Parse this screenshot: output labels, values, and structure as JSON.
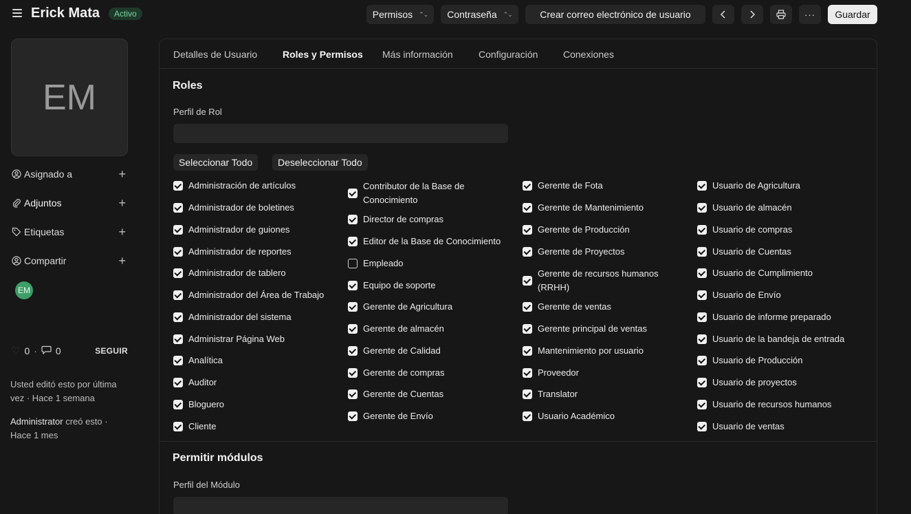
{
  "header": {
    "title": "Erick Mata",
    "status": "Activo",
    "buttons": {
      "permisos": "Permisos",
      "contrasena": "Contraseña",
      "crear_correo": "Crear correo electrónico de usuario",
      "guardar": "Guardar"
    }
  },
  "sidebar": {
    "avatar_initials": "EM",
    "rows": [
      {
        "label": "Asignado a",
        "icon": "user-assign-icon"
      },
      {
        "label": "Adjuntos",
        "icon": "paperclip-icon"
      },
      {
        "label": "Etiquetas",
        "icon": "tag-icon"
      },
      {
        "label": "Compartir",
        "icon": "share-user-icon"
      }
    ],
    "shared_avatar": "EM",
    "likes": "0",
    "comments": "0",
    "follow": "SEGUIR",
    "activity": [
      {
        "actor": "",
        "text": "Usted editó esto por última vez · Hace 1 semana"
      },
      {
        "actor": "Administrator",
        "text": " creó esto · Hace 1 mes"
      }
    ]
  },
  "tabs": [
    {
      "label": "Detalles de Usuario",
      "active": false
    },
    {
      "label": "Roles y Permisos",
      "active": true
    },
    {
      "label": "Más información",
      "active": false
    },
    {
      "label": "Configuración",
      "active": false
    },
    {
      "label": "Conexiones",
      "active": false
    }
  ],
  "roles_section": {
    "title": "Roles",
    "profile_label": "Perfil de Rol",
    "profile_value": "",
    "select_all": "Seleccionar Todo",
    "deselect_all": "Deseleccionar Todo",
    "columns": [
      [
        {
          "label": "Administración de artículos",
          "checked": true
        },
        {
          "label": "Administrador de boletines",
          "checked": true
        },
        {
          "label": "Administrador de guiones",
          "checked": true
        },
        {
          "label": "Administrador de reportes",
          "checked": true
        },
        {
          "label": "Administrador de tablero",
          "checked": true
        },
        {
          "label": "Administrador del Área de Trabajo",
          "checked": true
        },
        {
          "label": "Administrador del sistema",
          "checked": true
        },
        {
          "label": "Administrar Página Web",
          "checked": true
        },
        {
          "label": "Analítica",
          "checked": true
        },
        {
          "label": "Auditor",
          "checked": true
        },
        {
          "label": "Bloguero",
          "checked": true
        },
        {
          "label": "Cliente",
          "checked": true
        }
      ],
      [
        {
          "label": "Contributor de la Base de Conocimiento",
          "checked": true
        },
        {
          "label": "Director de compras",
          "checked": true
        },
        {
          "label": "Editor de la Base de Conocimiento",
          "checked": true
        },
        {
          "label": "Empleado",
          "checked": false
        },
        {
          "label": "Equipo de soporte",
          "checked": true
        },
        {
          "label": "Gerente de Agricultura",
          "checked": true
        },
        {
          "label": "Gerente de almacén",
          "checked": true
        },
        {
          "label": "Gerente de Calidad",
          "checked": true
        },
        {
          "label": "Gerente de compras",
          "checked": true
        },
        {
          "label": "Gerente de Cuentas",
          "checked": true
        },
        {
          "label": "Gerente de Envío",
          "checked": true
        }
      ],
      [
        {
          "label": "Gerente de Fota",
          "checked": true
        },
        {
          "label": "Gerente de Mantenimiento",
          "checked": true
        },
        {
          "label": "Gerente de Producción",
          "checked": true
        },
        {
          "label": "Gerente de Proyectos",
          "checked": true
        },
        {
          "label": "Gerente de recursos humanos (RRHH)",
          "checked": true
        },
        {
          "label": "Gerente de ventas",
          "checked": true
        },
        {
          "label": "Gerente principal de ventas",
          "checked": true
        },
        {
          "label": "Mantenimiento por usuario",
          "checked": true
        },
        {
          "label": "Proveedor",
          "checked": true
        },
        {
          "label": "Translator",
          "checked": true
        },
        {
          "label": "Usuario Académico",
          "checked": true
        }
      ],
      [
        {
          "label": "Usuario de Agricultura",
          "checked": true
        },
        {
          "label": "Usuario de almacén",
          "checked": true
        },
        {
          "label": "Usuario de compras",
          "checked": true
        },
        {
          "label": "Usuario de Cuentas",
          "checked": true
        },
        {
          "label": "Usuario de Cumplimiento",
          "checked": true
        },
        {
          "label": "Usuario de Envío",
          "checked": true
        },
        {
          "label": "Usuario de informe preparado",
          "checked": true
        },
        {
          "label": "Usuario de la bandeja de entrada",
          "checked": true
        },
        {
          "label": "Usuario de Producción",
          "checked": true
        },
        {
          "label": "Usuario de proyectos",
          "checked": true
        },
        {
          "label": "Usuario de recursos humanos",
          "checked": true
        },
        {
          "label": "Usuario de ventas",
          "checked": true
        }
      ]
    ]
  },
  "modules_section": {
    "title": "Permitir módulos",
    "profile_label": "Perfil del Módulo",
    "profile_value": ""
  }
}
